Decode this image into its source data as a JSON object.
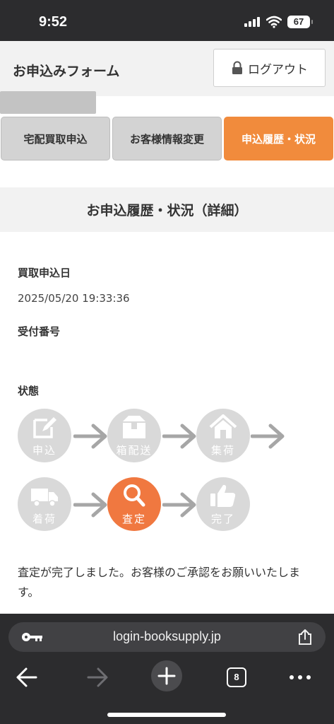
{
  "status_bar": {
    "time": "9:52",
    "battery": "67"
  },
  "header": {
    "title": "お申込みフォーム",
    "logout_label": "ログアウト"
  },
  "tabs": [
    {
      "label": "宅配買取申込",
      "active": false
    },
    {
      "label": "お客様情報変更",
      "active": false
    },
    {
      "label": "申込履歴・状況",
      "active": true
    }
  ],
  "section": {
    "title": "お申込履歴・状況（詳細）"
  },
  "details": {
    "date_label": "買取申込日",
    "date_value": "2025/05/20 19:33:36",
    "receipt_label": "受付番号",
    "receipt_value": "",
    "status_label": "状態"
  },
  "flow": {
    "steps": [
      {
        "label": "申込",
        "icon": "pencil-note-icon",
        "active": false
      },
      {
        "label": "箱配送",
        "icon": "box-icon",
        "active": false
      },
      {
        "label": "集荷",
        "icon": "house-icon",
        "active": false
      },
      {
        "label": "着荷",
        "icon": "truck-icon",
        "active": false
      },
      {
        "label": "査定",
        "icon": "magnifier-icon",
        "active": true
      },
      {
        "label": "完了",
        "icon": "thumbs-up-icon",
        "active": false
      }
    ],
    "active_color": "#f07840",
    "inactive_color": "#d9d9d9"
  },
  "message": "査定が完了しました。お客様のご承認をお願いいたします。",
  "browser": {
    "url": "login-booksupply.jp",
    "tab_count": "8"
  },
  "colors": {
    "accent": "#f18b3c",
    "header_bg": "#f2f2f2",
    "chrome": "#2c2c2e"
  }
}
